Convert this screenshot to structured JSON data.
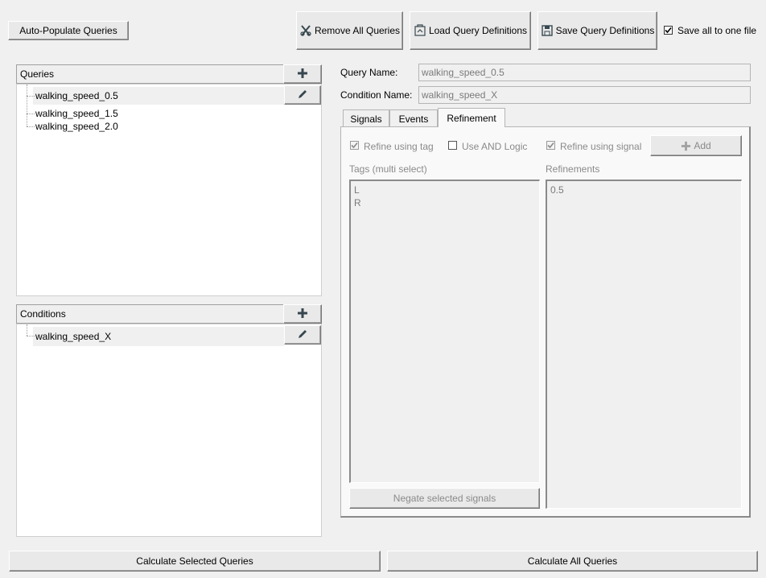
{
  "toolbar": {
    "auto_populate": "Auto-Populate Queries",
    "remove_all": "Remove All Queries",
    "load_defs": "Load Query Definitions",
    "save_defs": "Save Query Definitions",
    "save_all_one_file": "Save all to one file",
    "save_all_checked": true
  },
  "queries": {
    "header": "Queries",
    "items": [
      "walking_speed_0.5",
      "walking_speed_1.5",
      "walking_speed_2.0"
    ],
    "selected_index": 0
  },
  "conditions": {
    "header": "Conditions",
    "items": [
      "walking_speed_X"
    ],
    "selected_index": 0
  },
  "detail": {
    "query_name_label": "Query Name:",
    "query_name_value": "walking_speed_0.5",
    "condition_name_label": "Condition Name:",
    "condition_name_value": "walking_speed_X"
  },
  "tabs": {
    "items": [
      "Signals",
      "Events",
      "Refinement"
    ],
    "active": "Refinement"
  },
  "refinement": {
    "refine_tag": "Refine using tag",
    "refine_tag_checked": true,
    "use_and": "Use AND Logic",
    "use_and_checked": false,
    "refine_signal": "Refine using signal",
    "refine_signal_checked": true,
    "add_label": "Add",
    "tags_label": "Tags (multi select)",
    "tags": [
      "L",
      "R"
    ],
    "refinements_label": "Refinements",
    "refinements": [
      "0.5"
    ],
    "negate_label": "Negate selected signals"
  },
  "bottom": {
    "calc_selected": "Calculate Selected Queries",
    "calc_all": "Calculate All Queries"
  },
  "colors": {
    "window_bg": "#f0f0f0",
    "selection_bg": "#f0f0f0",
    "icon_dark": "#37474f"
  }
}
